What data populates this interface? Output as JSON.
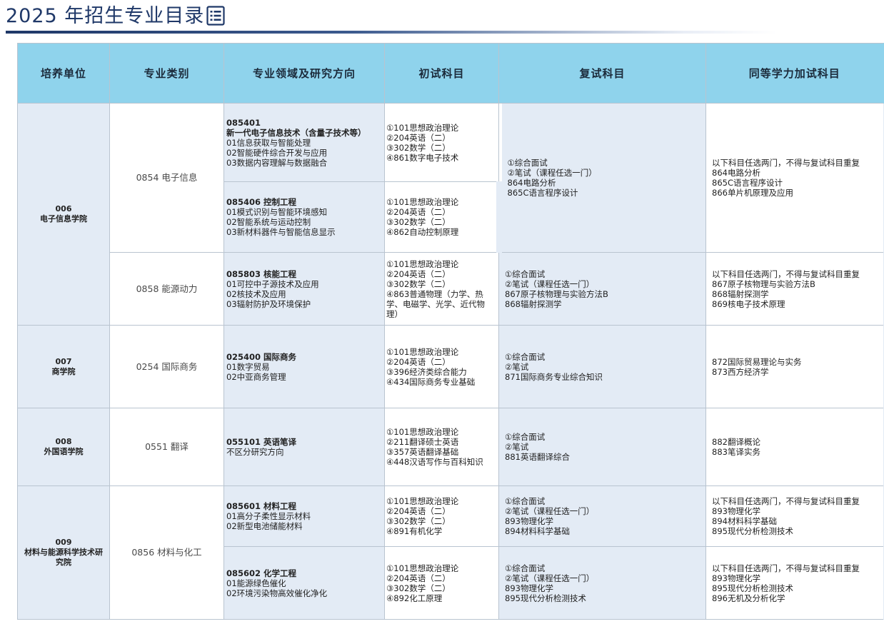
{
  "title": "2025 年招生专业目录",
  "columns": [
    "培养单位",
    "专业类别",
    "专业领域及研究方向",
    "初试科目",
    "复试科目",
    "同等学力加试科目"
  ],
  "units": {
    "u006": {
      "code": "006",
      "name": "电子信息学院"
    },
    "u007": {
      "code": "007",
      "name": "商学院"
    },
    "u008": {
      "code": "008",
      "name": "外国语学院"
    },
    "u009": {
      "code": "009",
      "name": "材料与能源科学技术研究院"
    }
  },
  "categories": {
    "c0854": "0854 电子信息",
    "c0858": "0858 能源动力",
    "c0254": "0254 国际商务",
    "c0551": "0551 翻译",
    "c0856": "0856 材料与化工"
  },
  "directions": {
    "d085401": {
      "code": "085401",
      "name": "新一代电子信息技术（含量子技术等）",
      "items": [
        "01信息获取与智能处理",
        "02智能硬件综合开发与应用",
        "03数据内容理解与数据融合"
      ]
    },
    "d085406": {
      "head": "085406 控制工程",
      "items": [
        "01模式识别与智能环境感知",
        "02智能系统与运动控制",
        "03新材料器件与智能信息显示"
      ]
    },
    "d085803": {
      "head": "085803 核能工程",
      "items": [
        "01可控中子源技术及应用",
        "02核技术及应用",
        "03辐射防护及环境保护"
      ]
    },
    "d025400": {
      "head": "025400 国际商务",
      "items": [
        "01数字贸易",
        "02中亚商务管理"
      ]
    },
    "d055101": {
      "head": "055101 英语笔译",
      "items": [
        "不区分研究方向"
      ]
    },
    "d085601": {
      "head": "085601 材料工程",
      "items": [
        "01高分子柔性显示材料",
        "02新型电池储能材料"
      ]
    },
    "d085602": {
      "head": "085602 化学工程",
      "items": [
        "01能源绿色催化",
        "02环境污染物高效催化净化"
      ]
    }
  },
  "initial_exams": {
    "i085401": [
      "①101思想政治理论",
      "②204英语（二）",
      "③302数学（二）",
      "④861数字电子技术"
    ],
    "i085406": [
      "①101思想政治理论",
      "②204英语（二）",
      "③302数学（二）",
      "④862自动控制原理"
    ],
    "i085803": [
      "①101思想政治理论",
      "②204英语（二）",
      "③302数学（二）",
      "④863普通物理（力学、热学、电磁学、光学、近代物理）"
    ],
    "i025400": [
      "①101思想政治理论",
      "②204英语（二）",
      "③396经济类综合能力",
      "④434国际商务专业基础"
    ],
    "i055101": [
      "①101思想政治理论",
      "②211翻译硕士英语",
      "③357英语翻译基础",
      "④448汉语写作与百科知识"
    ],
    "i085601": [
      "①101思想政治理论",
      "②204英语（二）",
      "③302数学（二）",
      "④891有机化学"
    ],
    "i085602": [
      "①101思想政治理论",
      "②204英语（二）",
      "③302数学（二）",
      "④892化工原理"
    ]
  },
  "retests": {
    "r0854": [
      "①综合面试",
      "②笔试（课程任选一门）",
      "864电路分析",
      "865C语言程序设计"
    ],
    "r0858": [
      "①综合面试",
      "②笔试（课程任选一门）",
      "867原子核物理与实验方法B",
      "868辐射探测学"
    ],
    "r0254": [
      "①综合面试",
      "②笔试",
      "871国际商务专业综合知识"
    ],
    "r0551": [
      "①综合面试",
      "②笔试",
      "881英语翻译综合"
    ],
    "r085601": [
      "①综合面试",
      "②笔试（课程任选一门）",
      "893物理化学",
      "894材料科学基础"
    ],
    "r085602": [
      "①综合面试",
      "②笔试（课程任选一门）",
      "893物理化学",
      "895现代分析检测技术"
    ]
  },
  "equivalents": {
    "e0854": [
      "以下科目任选两门，不得与复试科目重复",
      "864电路分析",
      "865C语言程序设计",
      "866单片机原理及应用"
    ],
    "e0858": [
      "以下科目任选两门，不得与复试科目重复",
      "867原子核物理与实验方法B",
      "868辐射探测学",
      "869核电子技术原理"
    ],
    "e0254": [
      "872国际贸易理论与实务",
      "873西方经济学"
    ],
    "e0551": [
      "882翻译概论",
      "883笔译实务"
    ],
    "e085601": [
      "以下科目任选两门，不得与复试科目重复",
      "893物理化学",
      "894材料科学基础",
      "895现代分析检测技术"
    ],
    "e085602": [
      "以下科目任选两门，不得与复试科目重复",
      "893物理化学",
      "895现代分析检测技术",
      "896无机及分析化学"
    ]
  }
}
